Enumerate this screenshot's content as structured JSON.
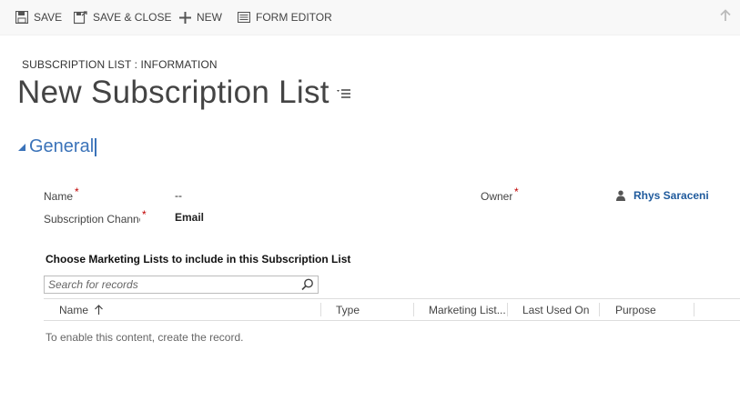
{
  "toolbar": {
    "save_label": "SAVE",
    "save_close_label": "SAVE & CLOSE",
    "new_label": "NEW",
    "form_editor_label": "FORM EDITOR"
  },
  "header": {
    "form_type": "SUBSCRIPTION LIST : INFORMATION",
    "title": "New Subscription List"
  },
  "section": {
    "title": "General"
  },
  "fields": {
    "name_label": "Name",
    "name_value": "--",
    "channel_label": "Subscription Channel",
    "channel_value": "Email",
    "owner_label": "Owner",
    "owner_value": "Rhys Saraceni",
    "required_mark": "*"
  },
  "subgrid": {
    "title": "Choose Marketing Lists to include in this Subscription List",
    "search_placeholder": "Search for records",
    "columns": [
      "Name",
      "Type",
      "Marketing List...",
      "Last Used On",
      "Purpose"
    ],
    "empty_message": "To enable this content, create the record."
  },
  "colors": {
    "accent": "#3b73b9",
    "link": "#1f5a9c",
    "required": "#c00000"
  }
}
